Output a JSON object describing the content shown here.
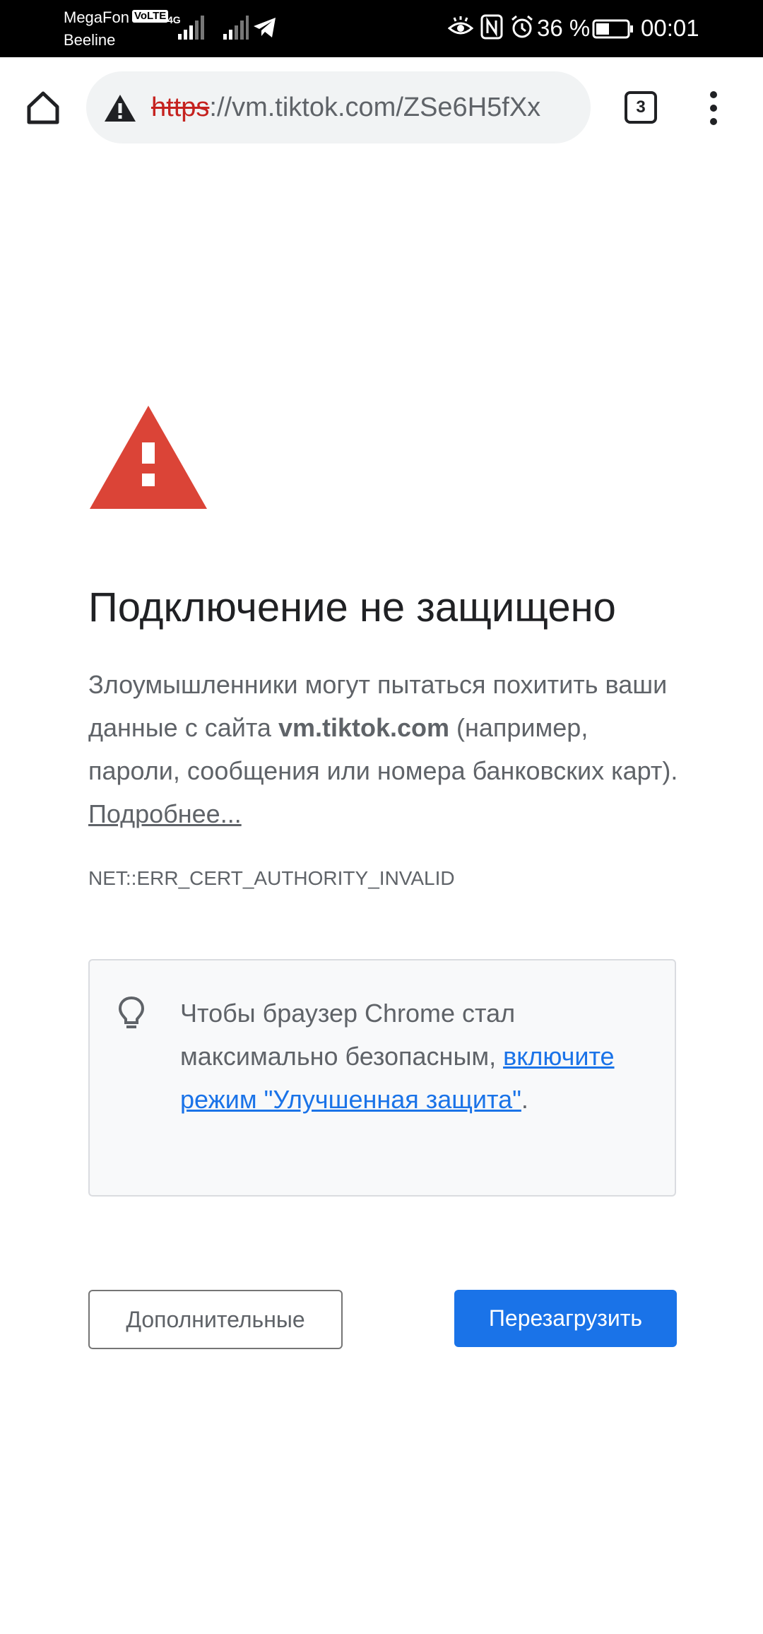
{
  "status_bar": {
    "carrier_primary": "MegaFon",
    "volte_badge": "VoLTE",
    "carrier_secondary": "Beeline",
    "network_type": "4G",
    "battery_percent": "36 %",
    "time": "00:01",
    "icons": [
      "signal-icon",
      "telegram-icon",
      "eye-comfort-icon",
      "nfc-icon",
      "alarm-icon",
      "battery-icon"
    ]
  },
  "toolbar": {
    "url_scheme": "https",
    "url_rest": "://vm.tiktok.com/ZSe6H5fXx",
    "tab_count": "3",
    "icons": [
      "home-icon",
      "not-secure-warning-icon",
      "more-options-icon"
    ]
  },
  "interstitial": {
    "heading": "Подключение не защищено",
    "body_part1": "Злоумышленники могут пытаться похитить ваши данные с сайта ",
    "body_domain": "vm.tiktok.com",
    "body_part2": " (например, пароли, сообщения или номера банковских карт). ",
    "learn_more": "Подробнее...",
    "error_code": "NET::ERR_CERT_AUTHORITY_INVALID",
    "tip_text": "Чтобы браузер Chrome стал максимально безопасным, ",
    "tip_link": "включите режим \"Улучшенная защита\"",
    "tip_end": ".",
    "advanced_button": "Дополнительные",
    "reload_button": "Перезагрузить"
  },
  "colors": {
    "warning_red": "#db4437",
    "link_blue": "#1a73e8",
    "button_blue": "#1a73e8",
    "text_gray": "#5f6368",
    "scheme_red": "#c5221f"
  }
}
